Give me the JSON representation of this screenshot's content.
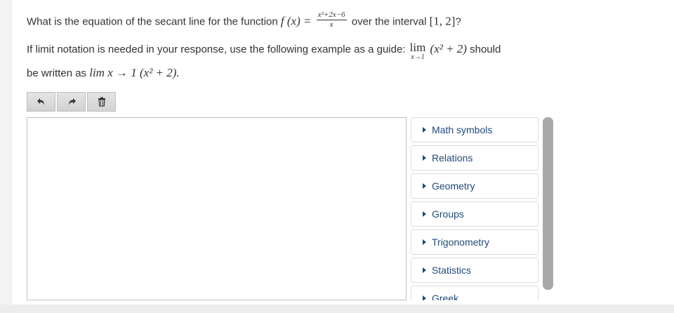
{
  "question": {
    "line1_prefix": "What is the equation of the secant line for the function",
    "func_name": "f (x) =",
    "frac_num": "x²+2x−6",
    "frac_den": "x",
    "line1_mid": "over the interval",
    "interval": "[1,  2]",
    "line1_suffix": "?",
    "line2_prefix": "If limit notation is needed in your response, use the following example as a guide:",
    "lim_word": "lim",
    "lim_sub": "x→1",
    "lim_expr": "(x² + 2)",
    "line2_suffix": "should",
    "line3_prefix": "be written as",
    "line3_math": "lim x → 1 (x² + 2).",
    "line3_suffix": ""
  },
  "toolbar": {
    "undo_icon": "undo-arrow-icon",
    "redo_icon": "redo-arrow-icon",
    "trash_icon": "trash-icon"
  },
  "palette": {
    "items": [
      {
        "label": "Math symbols"
      },
      {
        "label": "Relations"
      },
      {
        "label": "Geometry"
      },
      {
        "label": "Groups"
      },
      {
        "label": "Trigonometry"
      },
      {
        "label": "Statistics"
      },
      {
        "label": "Greek"
      }
    ]
  },
  "colors": {
    "link": "#1f4a7a",
    "text": "#333333"
  }
}
